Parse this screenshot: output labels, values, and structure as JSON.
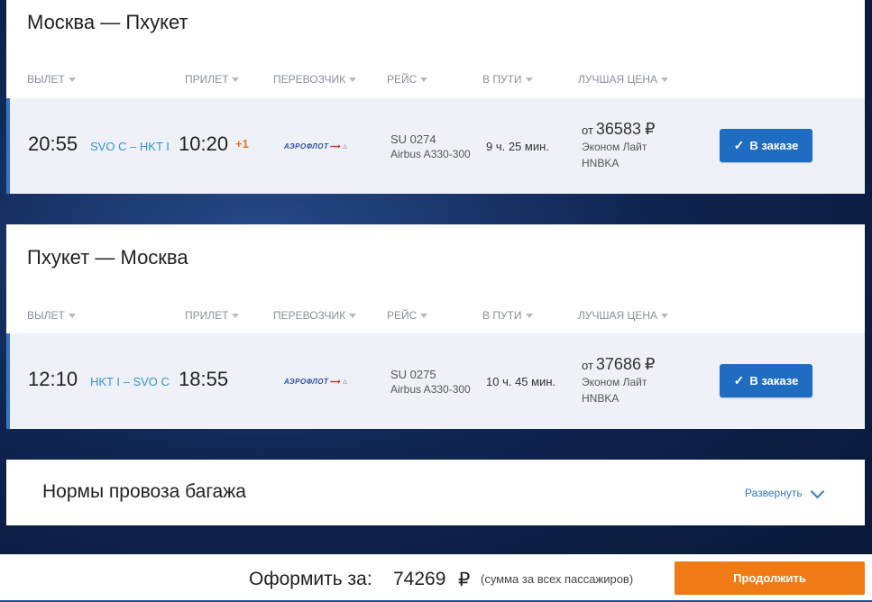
{
  "outbound": {
    "title": "Москва — Пхукет",
    "headers": [
      "ВЫЛЕТ",
      "ПРИЛЕТ",
      "ПЕРЕВОЗЧИК",
      "РЕЙС",
      "В ПУТИ",
      "ЛУЧШАЯ ЦЕНА"
    ],
    "departure_time": "20:55",
    "airports": "SVO C – HKT I",
    "arrival_time": "10:20",
    "day_shift": "+1",
    "carrier_logo": "АЭРОФЛОТ",
    "flight_number": "SU 0274",
    "aircraft": "Airbus A330-300",
    "duration": "9 ч. 25 мин.",
    "price_prefix": "от",
    "price": "36583",
    "currency": "₽",
    "fare": "Эконом Лайт",
    "fare_code": "HNBKA",
    "button_label": "В заказе"
  },
  "inbound": {
    "title": "Пхукет — Москва",
    "headers": [
      "ВЫЛЕТ",
      "ПРИЛЕТ",
      "ПЕРЕВОЗЧИК",
      "РЕЙС",
      "В ПУТИ",
      "ЛУЧШАЯ ЦЕНА"
    ],
    "departure_time": "12:10",
    "airports": "HKT I – SVO C",
    "arrival_time": "18:55",
    "carrier_logo": "АЭРОФЛОТ",
    "flight_number": "SU 0275",
    "aircraft": "Airbus A330-300",
    "duration": "10 ч. 45 мин.",
    "price_prefix": "от",
    "price": "37686",
    "currency": "₽",
    "fare": "Эконом Лайт",
    "fare_code": "HNBKA",
    "button_label": "В заказе"
  },
  "baggage": {
    "title": "Нормы провоза багажа",
    "expand_label": "Развернуть"
  },
  "footer": {
    "total_label": "Оформить за:",
    "total_amount": "74269",
    "currency": "₽",
    "note": "(сумма за всех пассажиров)",
    "continue_label": "Продолжить"
  },
  "colors": {
    "accent_blue": "#1e6dc3",
    "continue_orange": "#f07b16",
    "airport_blue": "#3a8fd1",
    "day_shift_orange": "#e07a1f"
  },
  "icons": [
    "check-icon",
    "chevron-down-icon",
    "caret-down-icon",
    "aeroflot-logo"
  ]
}
